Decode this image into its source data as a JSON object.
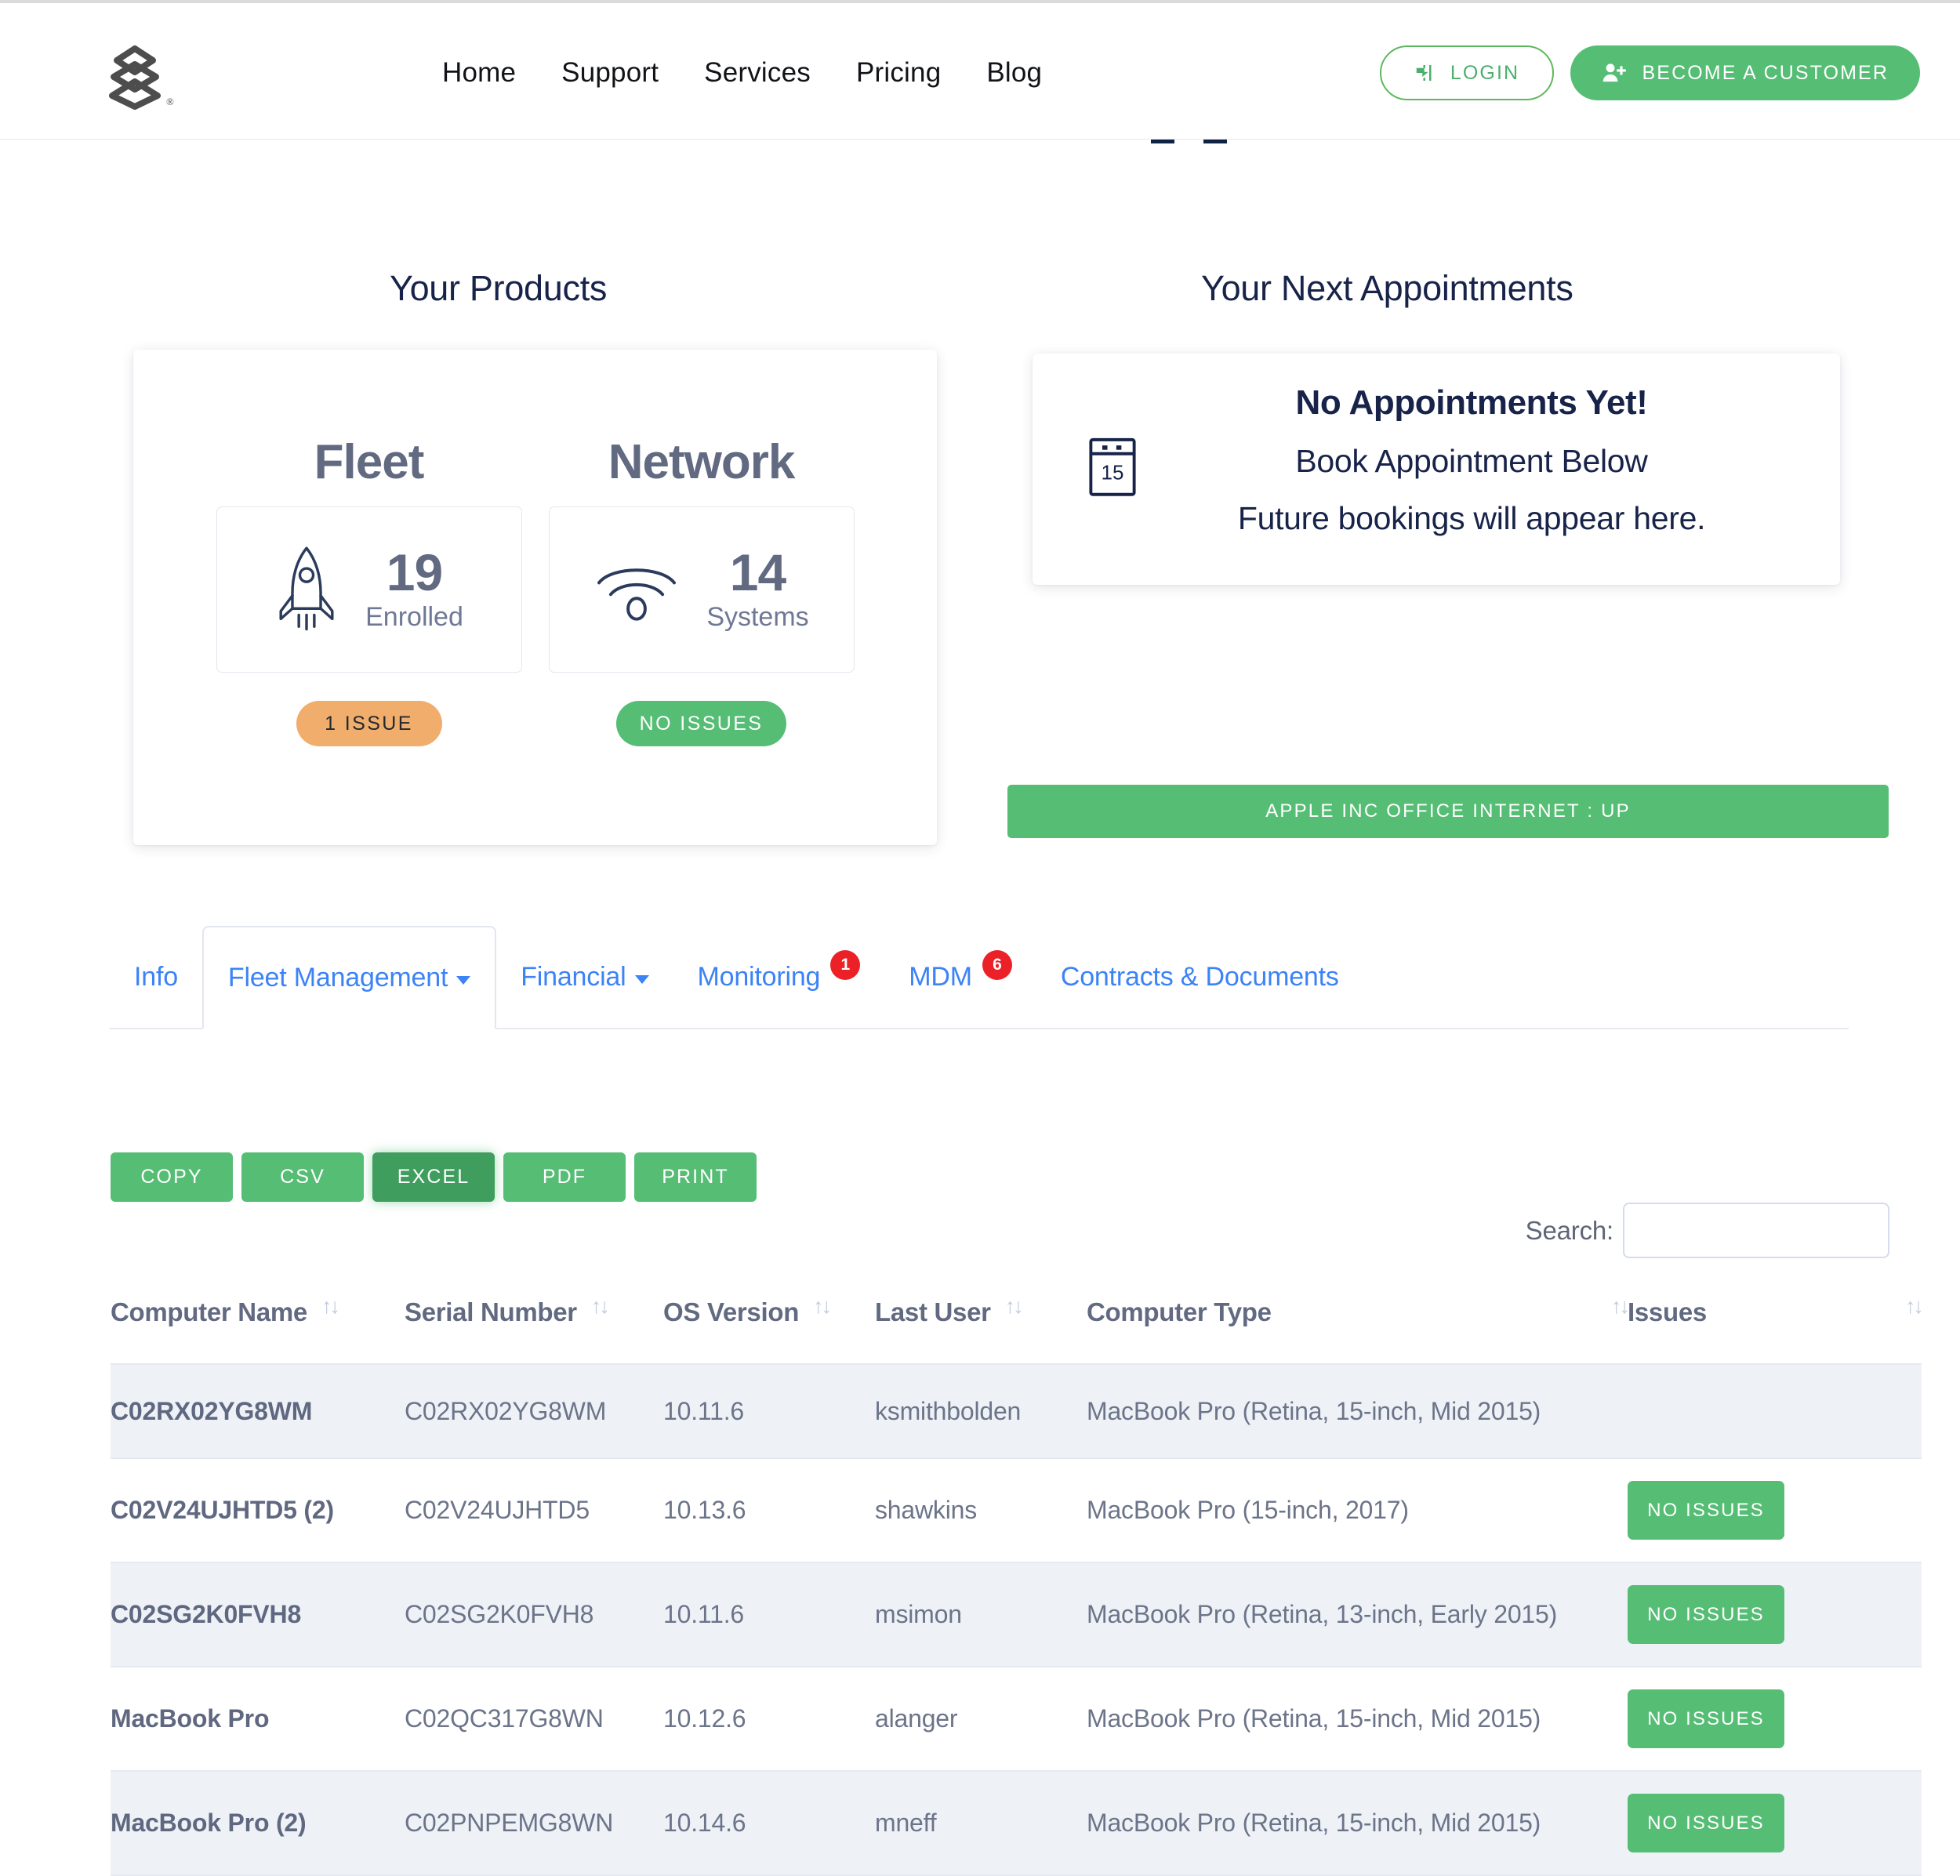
{
  "nav": {
    "logo_name": "company-logo",
    "links": [
      "Home",
      "Support",
      "Services",
      "Pricing",
      "Blog"
    ],
    "login_label": "LOGIN",
    "customer_label": "BECOME A CUSTOMER"
  },
  "products": {
    "heading": "Your Products",
    "columns": [
      {
        "name": "Fleet",
        "icon": "rocket-icon",
        "count": "19",
        "unit": "Enrolled",
        "status_label": "1 ISSUE",
        "status_kind": "warn"
      },
      {
        "name": "Network",
        "icon": "wifi-icon",
        "count": "14",
        "unit": "Systems",
        "status_label": "NO ISSUES",
        "status_kind": "ok"
      }
    ]
  },
  "appointments": {
    "heading": "Your Next Appointments",
    "calendar_icon": "calendar-icon",
    "calendar_day": "15",
    "title": "No Appointments Yet!",
    "line1": "Book Appointment Below",
    "line2": "Future bookings will appear here.",
    "internet_status": "APPLE INC OFFICE INTERNET : UP"
  },
  "tabs": [
    {
      "label": "Info",
      "active": false,
      "caret": false,
      "badge": null
    },
    {
      "label": "Fleet Management",
      "active": true,
      "caret": true,
      "badge": null
    },
    {
      "label": "Financial",
      "active": false,
      "caret": true,
      "badge": null
    },
    {
      "label": "Monitoring",
      "active": false,
      "caret": false,
      "badge": "1"
    },
    {
      "label": "MDM",
      "active": false,
      "caret": false,
      "badge": "6"
    },
    {
      "label": "Contracts & Documents",
      "active": false,
      "caret": false,
      "badge": null
    }
  ],
  "exports": [
    {
      "label": "COPY",
      "pressed": false
    },
    {
      "label": "CSV",
      "pressed": false
    },
    {
      "label": "EXCEL",
      "pressed": true
    },
    {
      "label": "PDF",
      "pressed": false
    },
    {
      "label": "PRINT",
      "pressed": false
    }
  ],
  "search": {
    "label": "Search:",
    "value": "",
    "placeholder": ""
  },
  "table": {
    "columns": [
      "Computer Name",
      "Serial Number",
      "OS Version",
      "Last User",
      "Computer Type",
      "Issues"
    ],
    "sort_icon": "sort-arrows-icon",
    "rows": [
      {
        "computer_name": "C02RX02YG8WM",
        "serial_number": "C02RX02YG8WM",
        "os_version": "10.11.6",
        "last_user": "ksmithbolden",
        "computer_type": "MacBook Pro (Retina, 15-inch, Mid 2015)",
        "issues": ""
      },
      {
        "computer_name": "C02V24UJHTD5 (2)",
        "serial_number": "C02V24UJHTD5",
        "os_version": "10.13.6",
        "last_user": "shawkins",
        "computer_type": "MacBook Pro (15-inch, 2017)",
        "issues": "NO ISSUES"
      },
      {
        "computer_name": "C02SG2K0FVH8",
        "serial_number": "C02SG2K0FVH8",
        "os_version": "10.11.6",
        "last_user": "msimon",
        "computer_type": "MacBook Pro (Retina, 13-inch, Early 2015)",
        "issues": "NO ISSUES"
      },
      {
        "computer_name": "MacBook Pro",
        "serial_number": "C02QC317G8WN",
        "os_version": "10.12.6",
        "last_user": "alanger",
        "computer_type": "MacBook Pro (Retina, 15-inch, Mid 2015)",
        "issues": "NO ISSUES"
      },
      {
        "computer_name": "MacBook Pro (2)",
        "serial_number": "C02PNPEMG8WN",
        "os_version": "10.14.6",
        "last_user": "mneff",
        "computer_type": "MacBook Pro (Retina, 15-inch, Mid 2015)",
        "issues": "NO ISSUES"
      }
    ]
  },
  "colors": {
    "brand_green": "#56bd75",
    "warn_orange": "#f0ad6b",
    "link_blue": "#3c83f6",
    "badge_red": "#ec2127",
    "navy": "#18234a",
    "slate": "#626a82",
    "row_stripe": "#eef2f7"
  }
}
